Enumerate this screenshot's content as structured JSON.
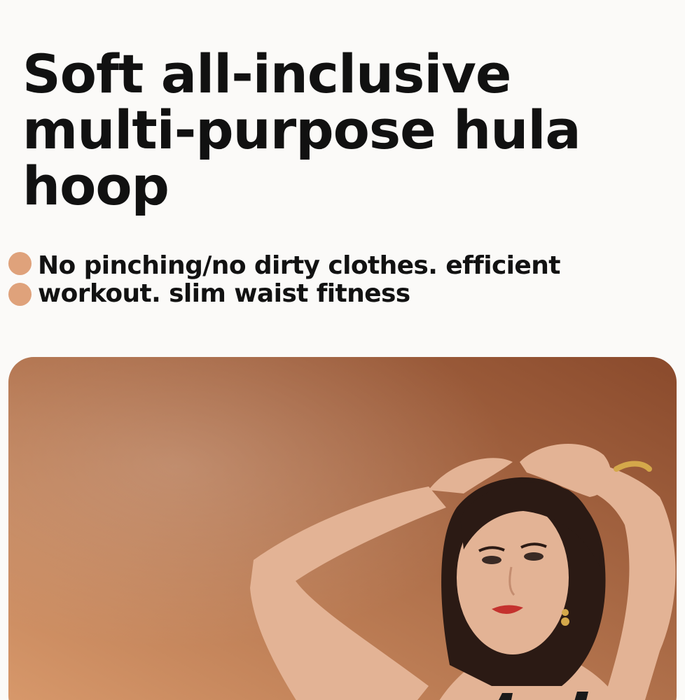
{
  "header": {
    "title": "Soft all-inclusive multi-purpose hula hoop"
  },
  "features": {
    "text": "No pinching/no dirty clothes. efficient workout. slim waist fitness",
    "bullet_color": "#dfa27b"
  },
  "photo": {
    "background_light": "#d99a6c",
    "background_dark": "#8a4a2c",
    "skin_color": "#e3b395",
    "hair_color": "#2b1a14"
  }
}
